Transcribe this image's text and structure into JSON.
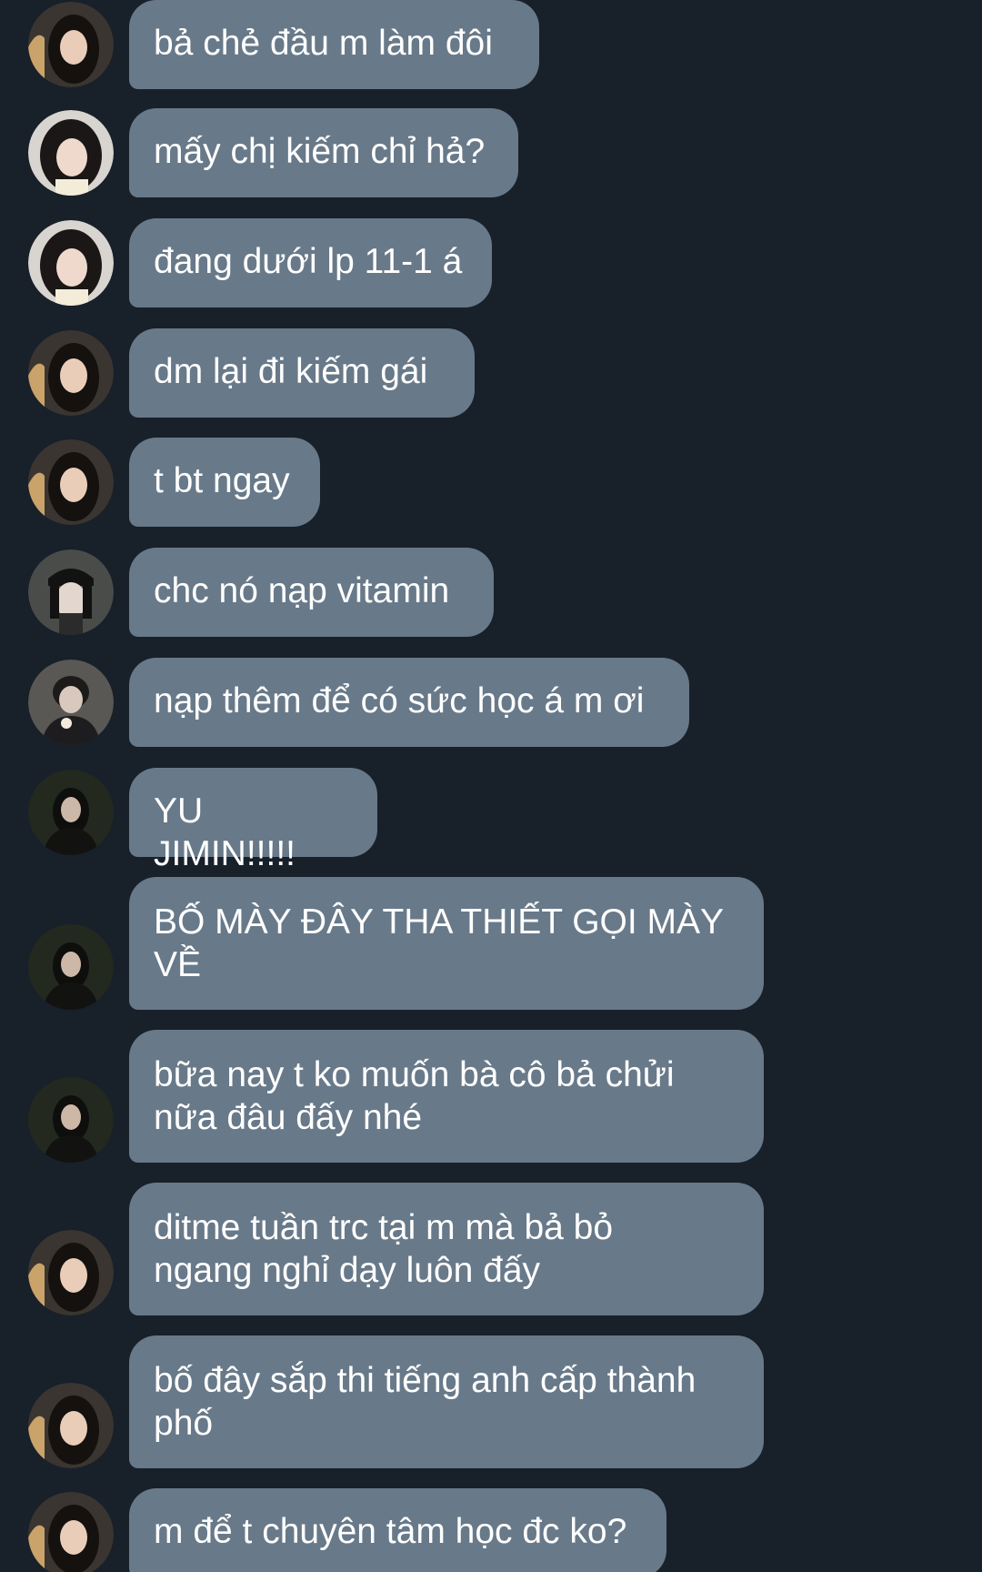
{
  "colors": {
    "background": "#18202a",
    "bubble": "#687989",
    "text": "#ffffff"
  },
  "messages": [
    {
      "text": "bả chẻ đầu m làm đôi",
      "avatar": "avatar-girl-long-hair-icon"
    },
    {
      "text": "mấy chị kiếm chỉ hả?",
      "avatar": "avatar-girl-selfie-icon"
    },
    {
      "text": "đang dưới lp 11-1 á",
      "avatar": "avatar-girl-selfie-icon"
    },
    {
      "text": "dm lại đi kiếm gái",
      "avatar": "avatar-girl-long-hair-icon"
    },
    {
      "text": "t bt ngay",
      "avatar": "avatar-girl-long-hair-icon"
    },
    {
      "text": "chc nó nạp vitamin",
      "avatar": "avatar-girl-cap-icon"
    },
    {
      "text": "nạp thêm để có sức học á m ơi",
      "avatar": "avatar-boy-icecream-icon"
    },
    {
      "text": "YU JIMIN!!!!!",
      "avatar": "avatar-girl-dark-jacket-icon"
    },
    {
      "text": "BỐ MÀY ĐÂY THA THIẾT GỌI MÀY\nVỀ",
      "avatar": "avatar-girl-dark-jacket-icon"
    },
    {
      "text": "bữa nay t ko muốn bà cô bả chửi\nnữa đâu đấy nhé",
      "avatar": "avatar-girl-dark-jacket-icon"
    },
    {
      "text": "ditme tuần trc tại m mà bả bỏ\nngang nghỉ dạy luôn đấy",
      "avatar": "avatar-girl-long-hair-icon"
    },
    {
      "text": "bố đây sắp thi tiếng anh cấp thành\nphố",
      "avatar": "avatar-girl-long-hair-icon"
    },
    {
      "text": "m để t chuyên tâm học đc ko?",
      "avatar": "avatar-girl-long-hair-icon"
    }
  ]
}
